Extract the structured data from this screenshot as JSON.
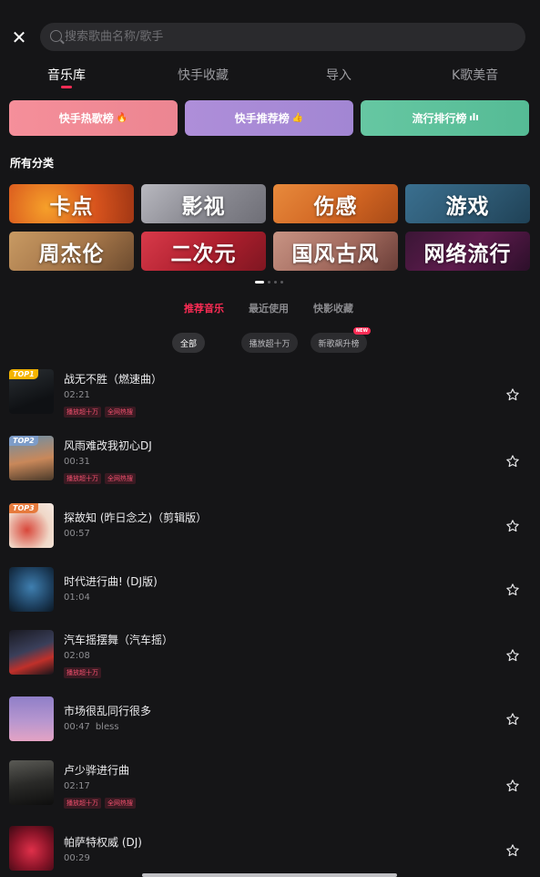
{
  "search": {
    "placeholder": "搜索歌曲名称/歌手"
  },
  "main_tabs": [
    "音乐库",
    "快手收藏",
    "导入",
    "K歌美音"
  ],
  "rank_buttons": [
    {
      "label": "快手热歌榜",
      "icon": "flame-icon",
      "color": "#f08b97"
    },
    {
      "label": "快手推荐榜",
      "icon": "thumbs-up-icon",
      "color": "#a98ad6"
    },
    {
      "label": "流行排行榜",
      "icon": "bar-chart-icon",
      "color": "#5bbf9a"
    }
  ],
  "categories_title": "所有分类",
  "categories": [
    "卡点",
    "影视",
    "伤感",
    "游戏",
    "周杰伦",
    "二次元",
    "国风古风",
    "网络流行"
  ],
  "sub_tabs": [
    "推荐音乐",
    "最近使用",
    "快影收藏"
  ],
  "filter_chips": [
    {
      "label": "全部"
    },
    {
      "label": "播放超十万"
    },
    {
      "label": "新歌飙升榜",
      "badge": "NEW"
    }
  ],
  "songs": [
    {
      "title": "战无不胜（燃速曲）",
      "duration": "02:21",
      "artist": "",
      "rank": "TOP1",
      "tags": [
        "播放超十万",
        "全网热搜"
      ]
    },
    {
      "title": "风雨难改我初心DJ",
      "duration": "00:31",
      "artist": "",
      "rank": "TOP2",
      "tags": [
        "播放超十万",
        "全网热搜"
      ]
    },
    {
      "title": "探故知 (昨日念之)（剪辑版）",
      "duration": "00:57",
      "artist": "",
      "rank": "TOP3",
      "tags": []
    },
    {
      "title": "时代进行曲! (DJ版)",
      "duration": "01:04",
      "artist": "",
      "rank": "",
      "tags": []
    },
    {
      "title": "汽车摇摆舞（汽车摇）",
      "duration": "02:08",
      "artist": "",
      "rank": "",
      "tags": [
        "播放超十万"
      ]
    },
    {
      "title": "市场很乱同行很多",
      "duration": "00:47",
      "artist": "bless",
      "rank": "",
      "tags": []
    },
    {
      "title": "卢少骅进行曲",
      "duration": "02:17",
      "artist": "",
      "rank": "",
      "tags": [
        "播放超十万",
        "全网热搜"
      ]
    },
    {
      "title": "帕萨特权威 (DJ)",
      "duration": "00:29",
      "artist": "",
      "rank": "",
      "tags": []
    }
  ],
  "colors": {
    "accent": "#fe2c55",
    "background": "#151517"
  }
}
